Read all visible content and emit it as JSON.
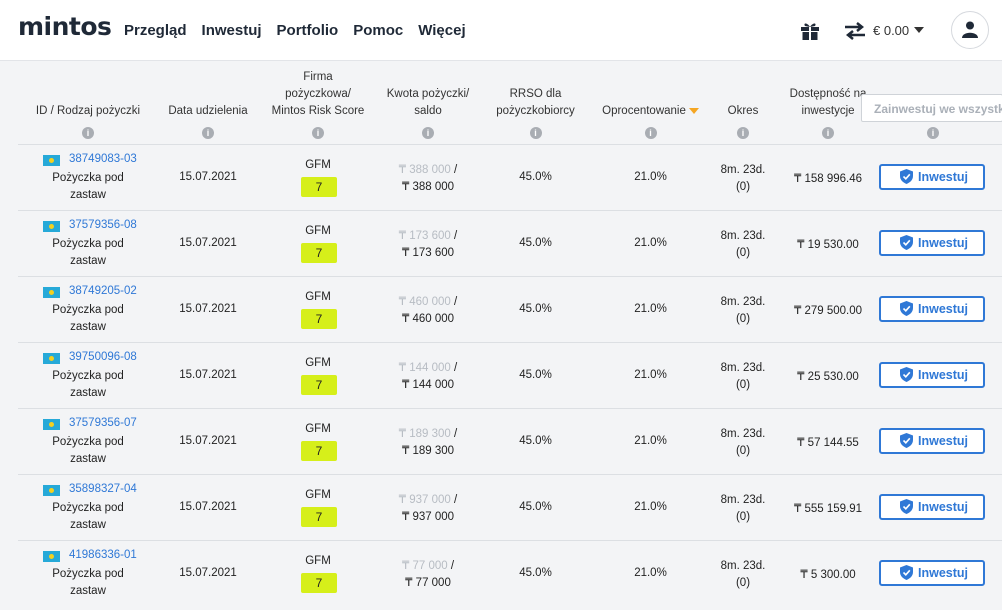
{
  "brand": "mintos",
  "nav": [
    "Przegląd",
    "Inwestuj",
    "Portfolio",
    "Pomoc",
    "Więcej"
  ],
  "balance": "€ 0.00",
  "columns": {
    "id": "ID / Rodzaj pożyczki",
    "date": "Data udzielenia",
    "firm": [
      "Firma",
      "pożyczkowa/",
      "Mintos Risk Score"
    ],
    "amount": [
      "Kwota pożyczki/",
      "saldo"
    ],
    "rrso": [
      "RRSO dla",
      "pożyczkobiorcy"
    ],
    "rate": "Oprocentowanie",
    "term": "Okres",
    "avail": [
      "Dostępność na",
      "inwestycje"
    ],
    "invest_all": "Zainwestuj we wszystkie"
  },
  "info_glyph": "i",
  "colors": {
    "accent": "#2f78d6",
    "score": "#d6ef1a",
    "sort": "#f5a623"
  },
  "loans": [
    {
      "id": "38749083-03",
      "type": [
        "Pożyczka pod",
        "zastaw"
      ],
      "date": "15.07.2021",
      "company": "GFM",
      "score": "7",
      "amount_orig": "₸ 388 000",
      "amount_sep": " /",
      "amount_bal": "₸ 388 000",
      "rrso": "45.0%",
      "rate": "21.0%",
      "term": "8m. 23d.",
      "term_sub": "(0)",
      "available": "₸ 158 996.46",
      "button": "Inwestuj"
    },
    {
      "id": "37579356-08",
      "type": [
        "Pożyczka pod",
        "zastaw"
      ],
      "date": "15.07.2021",
      "company": "GFM",
      "score": "7",
      "amount_orig": "₸ 173 600",
      "amount_sep": " /",
      "amount_bal": "₸ 173 600",
      "rrso": "45.0%",
      "rate": "21.0%",
      "term": "8m. 23d.",
      "term_sub": "(0)",
      "available": "₸ 19 530.00",
      "button": "Inwestuj"
    },
    {
      "id": "38749205-02",
      "type": [
        "Pożyczka pod",
        "zastaw"
      ],
      "date": "15.07.2021",
      "company": "GFM",
      "score": "7",
      "amount_orig": "₸ 460 000",
      "amount_sep": " /",
      "amount_bal": "₸ 460 000",
      "rrso": "45.0%",
      "rate": "21.0%",
      "term": "8m. 23d.",
      "term_sub": "(0)",
      "available": "₸ 279 500.00",
      "button": "Inwestuj"
    },
    {
      "id": "39750096-08",
      "type": [
        "Pożyczka pod",
        "zastaw"
      ],
      "date": "15.07.2021",
      "company": "GFM",
      "score": "7",
      "amount_orig": "₸ 144 000",
      "amount_sep": " /",
      "amount_bal": "₸ 144 000",
      "rrso": "45.0%",
      "rate": "21.0%",
      "term": "8m. 23d.",
      "term_sub": "(0)",
      "available": "₸ 25 530.00",
      "button": "Inwestuj"
    },
    {
      "id": "37579356-07",
      "type": [
        "Pożyczka pod",
        "zastaw"
      ],
      "date": "15.07.2021",
      "company": "GFM",
      "score": "7",
      "amount_orig": "₸ 189 300",
      "amount_sep": " /",
      "amount_bal": "₸ 189 300",
      "rrso": "45.0%",
      "rate": "21.0%",
      "term": "8m. 23d.",
      "term_sub": "(0)",
      "available": "₸ 57 144.55",
      "button": "Inwestuj"
    },
    {
      "id": "35898327-04",
      "type": [
        "Pożyczka pod",
        "zastaw"
      ],
      "date": "15.07.2021",
      "company": "GFM",
      "score": "7",
      "amount_orig": "₸ 937 000",
      "amount_sep": " /",
      "amount_bal": "₸ 937 000",
      "rrso": "45.0%",
      "rate": "21.0%",
      "term": "8m. 23d.",
      "term_sub": "(0)",
      "available": "₸ 555 159.91",
      "button": "Inwestuj"
    },
    {
      "id": "41986336-01",
      "type": [
        "Pożyczka pod",
        "zastaw"
      ],
      "date": "15.07.2021",
      "company": "GFM",
      "score": "7",
      "amount_orig": "₸ 77 000",
      "amount_sep": " /",
      "amount_bal": "₸ 77 000",
      "rrso": "45.0%",
      "rate": "21.0%",
      "term": "8m. 23d.",
      "term_sub": "(0)",
      "available": "₸ 5 300.00",
      "button": "Inwestuj"
    }
  ]
}
